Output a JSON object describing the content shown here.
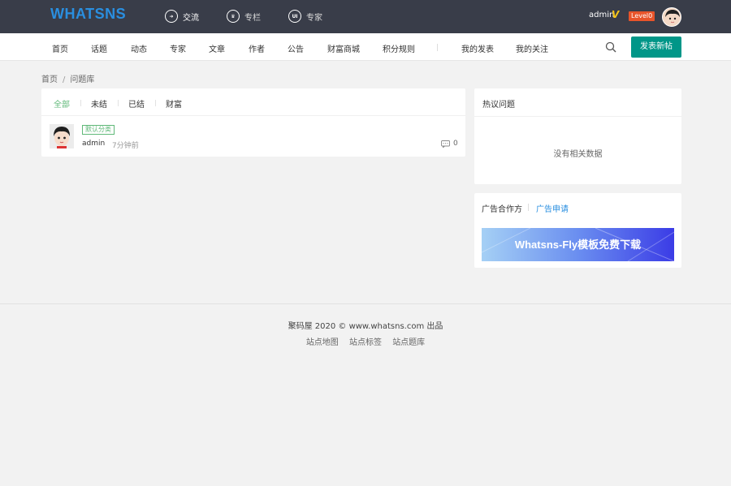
{
  "header": {
    "logo": "WHATSNS",
    "nav": [
      {
        "label": "交流",
        "icon": "compass-icon"
      },
      {
        "label": "专栏",
        "icon": "crown-icon"
      },
      {
        "label": "专家",
        "icon": "ui-badge-icon"
      }
    ],
    "user": {
      "name": "admin",
      "vip": "V",
      "level": "Level0"
    }
  },
  "subnav": {
    "items": [
      "首页",
      "话题",
      "动态",
      "专家",
      "文章",
      "作者",
      "公告",
      "财富商城",
      "积分规则"
    ],
    "my_posts": "我的发表",
    "my_follows": "我的关注",
    "post_button": "发表新帖"
  },
  "breadcrumb": {
    "home": "首页",
    "sep": "/",
    "current": "问题库"
  },
  "question_list": {
    "tabs": [
      "全部",
      "未结",
      "已结",
      "财富"
    ],
    "items": [
      {
        "category": "默认分类",
        "title": "",
        "author": "admin",
        "time": "7分钟前",
        "comments": "0"
      }
    ]
  },
  "hot": {
    "title": "热议问题",
    "empty": "没有相关数据"
  },
  "ads": {
    "title": "广告合作方",
    "link": "广告申请",
    "banner_text": "Whatsns-Fly模板免费下载"
  },
  "footer": {
    "copy": "聚码屋  2020 ©  www.whatsns.com 出品",
    "links": [
      "站点地图",
      "站点标签",
      "站点题库"
    ]
  },
  "colors": {
    "topbar": "#393d49",
    "accent": "#009688",
    "active_tab": "#5fb878",
    "link": "#2a8fe0"
  }
}
